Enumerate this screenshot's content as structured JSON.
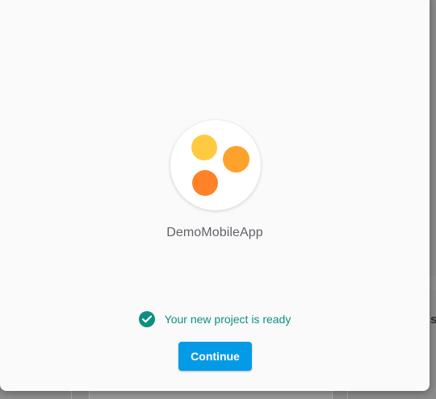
{
  "project": {
    "name": "DemoMobileApp",
    "logo_icon": "three-dots-logo-icon",
    "logo_colors": [
      "#ffc940",
      "#ffa22b",
      "#ff8128"
    ]
  },
  "status": {
    "icon": "check-circle-icon",
    "text": "Your new project is ready",
    "color": "#0d8f83"
  },
  "actions": {
    "continue_label": "Continue",
    "continue_color": "#039be5"
  }
}
